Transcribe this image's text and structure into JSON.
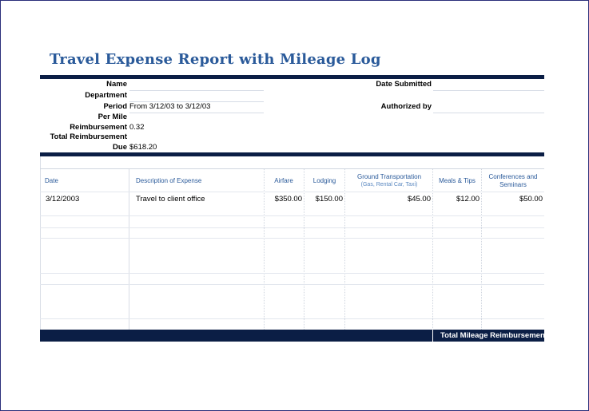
{
  "report": {
    "title": "Travel Expense Report with Mileage Log"
  },
  "info": {
    "name_label": "Name",
    "department_label": "Department",
    "period_label": "Period",
    "period_value": "From 3/12/03 to 3/12/03",
    "per_mile_label": "Per Mile",
    "reimbursement_label": "Reimbursement",
    "reimbursement_value": "0.32",
    "total_reimbursement_label": "Total Reimbursement",
    "due_label": "Due",
    "due_value": "$618.20",
    "date_submitted_label": "Date Submitted",
    "authorized_by_label": "Authorized by"
  },
  "table": {
    "headers": {
      "date": "Date",
      "description": "Description of Expense",
      "airfare": "Airfare",
      "lodging": "Lodging",
      "ground": "Ground Transportation",
      "ground_sub": "(Gas, Rental Car, Taxi)",
      "meals": "Meals & Tips",
      "conferences": "Conferences and Seminars"
    },
    "rows": [
      {
        "date": "3/12/2003",
        "description": "Travel to client office",
        "airfare": "$350.00",
        "lodging": "$150.00",
        "ground": "$45.00",
        "meals": "$12.00",
        "conferences": "$50.00"
      }
    ],
    "total_label": "Total Mileage Reimbursement"
  },
  "colors": {
    "title": "#2a5a9a",
    "bar": "#0b1e45",
    "header_text": "#2a5a9a"
  }
}
